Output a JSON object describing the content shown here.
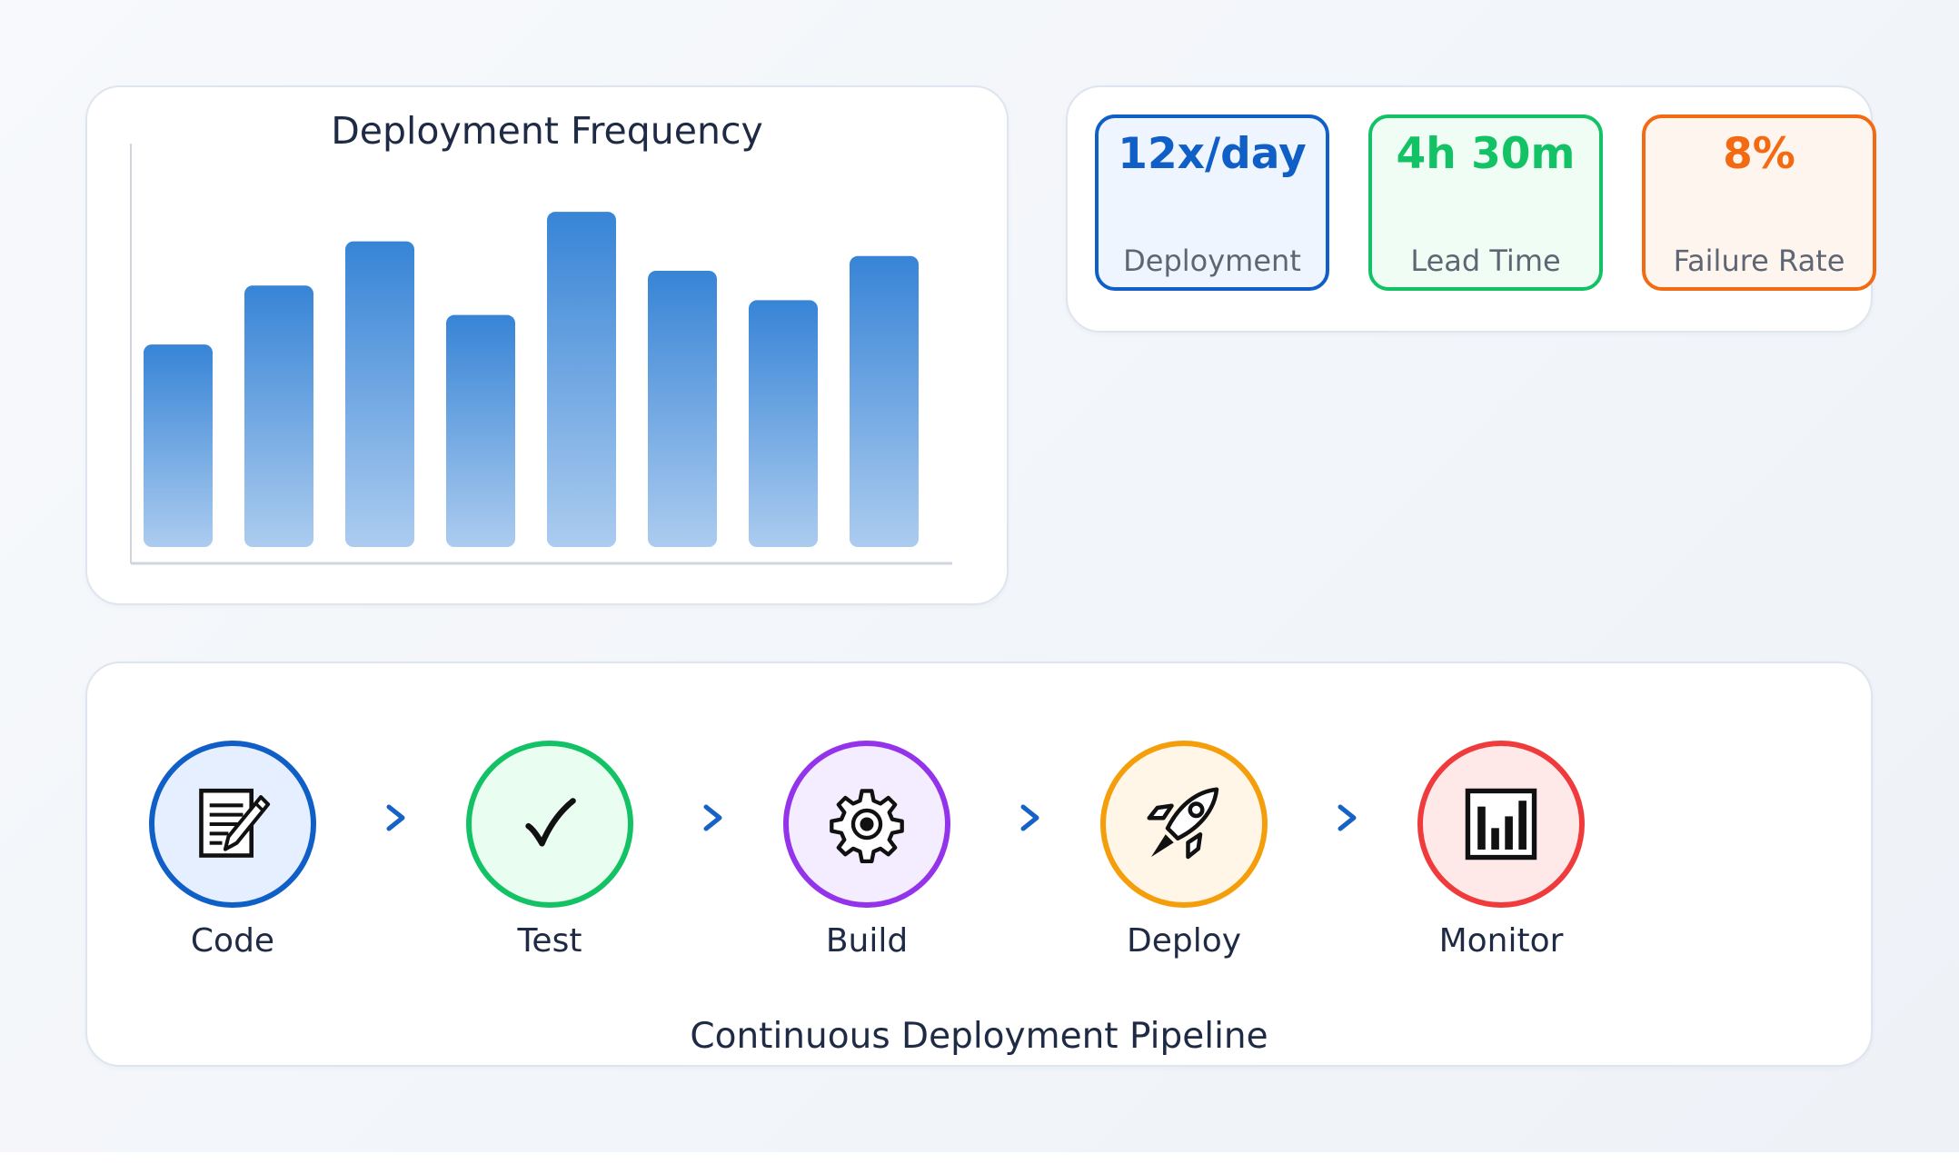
{
  "chart_data": {
    "type": "bar",
    "title": "Deployment Frequency",
    "categories": [],
    "values": [
      22,
      28.4,
      33.2,
      25.2,
      36.4,
      30,
      26.8,
      31.6
    ],
    "ylim": [
      0,
      45
    ],
    "grid": false,
    "bar_color_top": "#3784d6",
    "bar_color_bottom": "#acccef",
    "axis_color": "#cfd6e0"
  },
  "metrics": [
    {
      "value": "12x/day",
      "label": "Deployment",
      "color": "#0f5fc7",
      "bg": "#eef5fe"
    },
    {
      "value": "4h 30m",
      "label": "Lead Time",
      "color": "#14c266",
      "bg": "#effdf4"
    },
    {
      "value": "8%",
      "label": "Failure Rate",
      "color": "#f26b13",
      "bg": "#fff5ef"
    }
  ],
  "pipeline": {
    "caption": "Continuous Deployment Pipeline",
    "stages": [
      {
        "label": "Code",
        "icon": "memo-icon",
        "color": "#0f5fc7",
        "bg": "#e5efff"
      },
      {
        "label": "Test",
        "icon": "checkmark-icon",
        "color": "#14c266",
        "bg": "#e9fdf0"
      },
      {
        "label": "Build",
        "icon": "gear-icon",
        "color": "#9333ea",
        "bg": "#f3edff"
      },
      {
        "label": "Deploy",
        "icon": "rocket-icon",
        "color": "#f59e0b",
        "bg": "#fff6e8"
      },
      {
        "label": "Monitor",
        "icon": "bar-chart-icon",
        "color": "#ef3b3b",
        "bg": "#ffe8e8"
      }
    ],
    "arrow_color": "#1762c6"
  }
}
